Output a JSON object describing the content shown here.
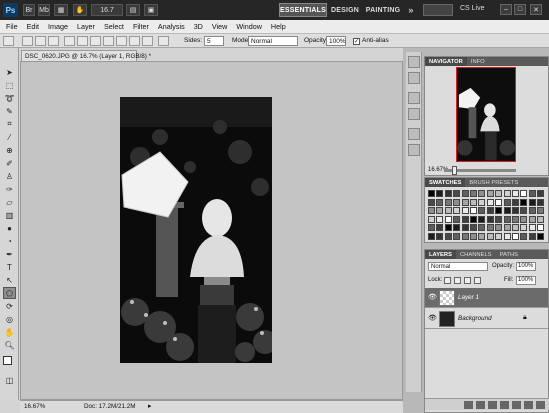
{
  "appbar": {
    "logo": "Ps",
    "zoom_value": "16.7",
    "workspaces": [
      "ESSENTIALS",
      "DESIGN",
      "PAINTING",
      "»"
    ],
    "cslive_label": "CS Live"
  },
  "menu": [
    "File",
    "Edit",
    "Image",
    "Layer",
    "Select",
    "Filter",
    "Analysis",
    "3D",
    "View",
    "Window",
    "Help"
  ],
  "options": {
    "sides_label": "Sides:",
    "sides_value": "5",
    "mode_label": "Mode:",
    "mode_value": "Normal",
    "opacity_label": "Opacity:",
    "opacity_value": "100%",
    "antialias_label": "Anti-alias"
  },
  "document": {
    "tab_title": "DSC_0620.JPG @ 16.7% (Layer 1, RGB/8) *",
    "status_zoom": "16.67%",
    "status_doc": "Doc: 17.2M/21.2M"
  },
  "navigator": {
    "tabs": [
      "NAVIGATOR",
      "INFO"
    ],
    "zoom": "16.67%"
  },
  "swatches": {
    "tabs": [
      "SWATCHES",
      "BRUSH PRESETS"
    ]
  },
  "layers": {
    "tabs": [
      "LAYERS",
      "CHANNELS",
      "PATHS"
    ],
    "blend_mode": "Normal",
    "opacity_label": "Opacity:",
    "opacity_value": "100%",
    "lock_label": "Lock:",
    "fill_label": "Fill:",
    "fill_value": "100%",
    "items": [
      {
        "name": "Layer 1",
        "selected": true
      },
      {
        "name": "Background",
        "selected": false
      }
    ]
  },
  "colors": {
    "appbar": "#262626",
    "accent_selected_layer": "#6b6b6b",
    "canvas_bg": "#c4c4c4"
  }
}
